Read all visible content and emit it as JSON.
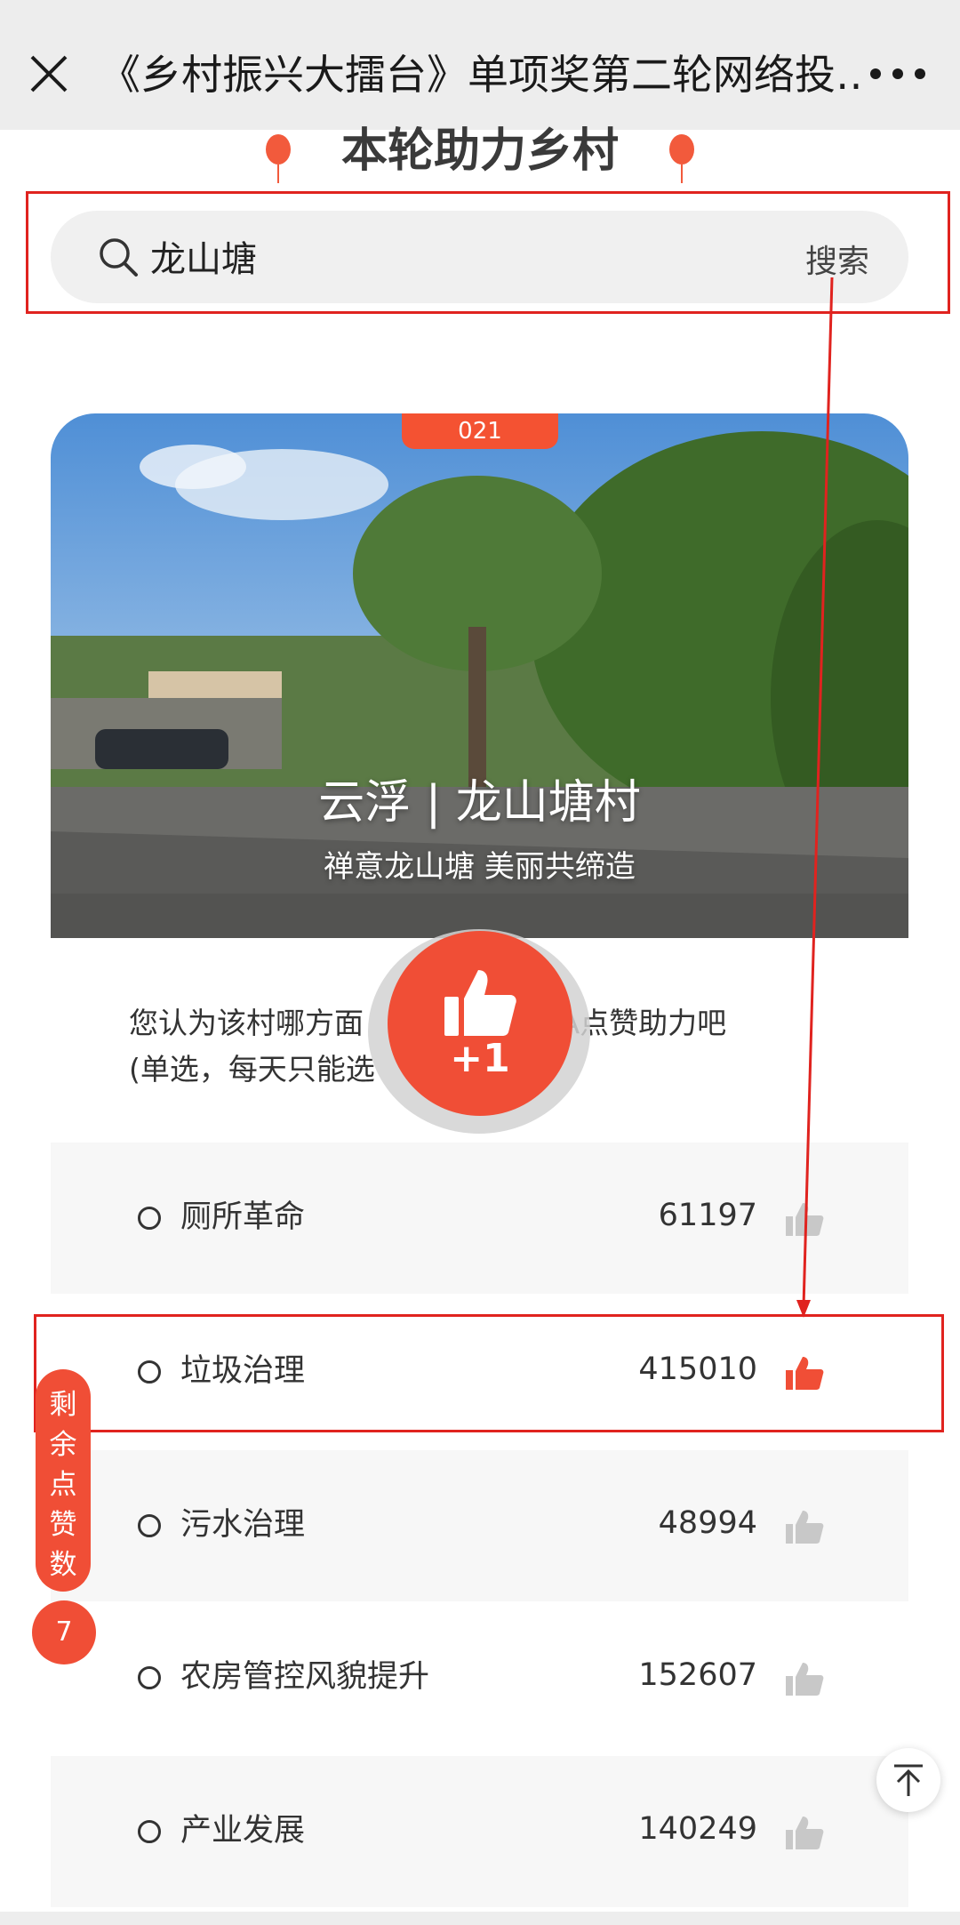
{
  "topbar": {
    "title": "《乡村振兴大擂台》单项奖第二轮网络投…",
    "close_icon": "close-icon",
    "more_icon": "more-icon"
  },
  "section": {
    "title": "本轮助力乡村"
  },
  "search": {
    "value": "龙山塘",
    "button_label": "搜索"
  },
  "village": {
    "code": "021",
    "name": "云浮 | 龙山塘村",
    "slogan": "禅意龙山塘 美丽共缔造",
    "question": "您认为该村哪方面做得好？为TA点赞助力吧(单选，每天只能选一次)",
    "question_line1": "您认为该村哪方面",
    "question_line1b": "为TA点赞助力吧",
    "question_line2": "(单选，每天只能选"
  },
  "like_popup": {
    "label": "+1"
  },
  "options": [
    {
      "label": "厕所革命",
      "count": "61197",
      "liked": false
    },
    {
      "label": "垃圾治理",
      "count": "415010",
      "liked": true
    },
    {
      "label": "污水治理",
      "count": "48994",
      "liked": false
    },
    {
      "label": "农房管控风貌提升",
      "count": "152607",
      "liked": false
    },
    {
      "label": "产业发展",
      "count": "140249",
      "liked": false
    }
  ],
  "remaining": {
    "label": "剩余点赞数",
    "count": "7"
  },
  "colors": {
    "accent": "#f04e36",
    "annotation": "#e0231f",
    "like_inactive": "#c8c8c8"
  }
}
